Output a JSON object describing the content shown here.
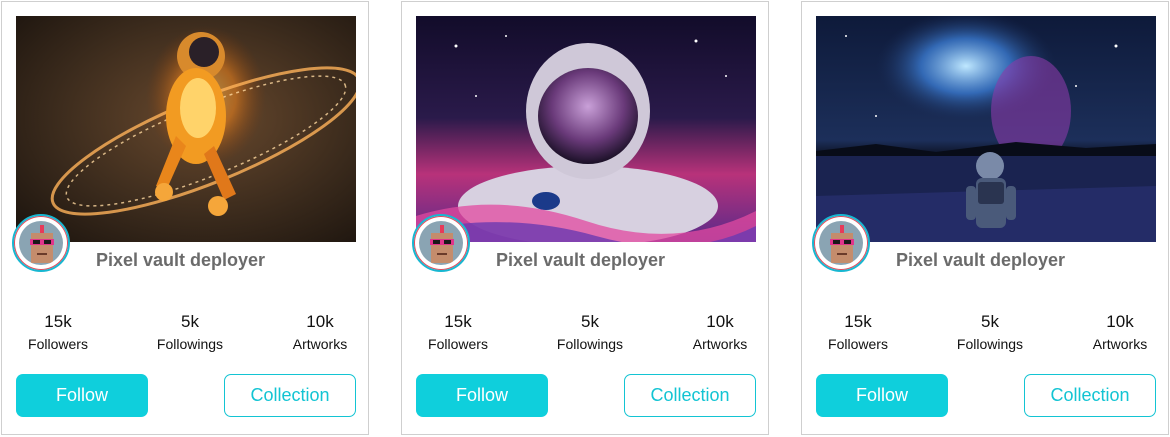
{
  "cards": [
    {
      "artwork": "glowing-astronaut-ring-artwork",
      "name": "Pixel vault deployer",
      "stats": [
        {
          "value": "15k",
          "label": "Followers"
        },
        {
          "value": "5k",
          "label": "Followings"
        },
        {
          "value": "10k",
          "label": "Artworks"
        }
      ],
      "follow_label": "Follow",
      "collection_label": "Collection"
    },
    {
      "artwork": "astronaut-in-cosmic-water-artwork",
      "name": "Pixel vault deployer",
      "stats": [
        {
          "value": "15k",
          "label": "Followers"
        },
        {
          "value": "5k",
          "label": "Followings"
        },
        {
          "value": "10k",
          "label": "Artworks"
        }
      ],
      "follow_label": "Follow",
      "collection_label": "Collection"
    },
    {
      "artwork": "astronaut-in-field-galaxy-artwork",
      "name": "Pixel vault deployer",
      "stats": [
        {
          "value": "15k",
          "label": "Followers"
        },
        {
          "value": "5k",
          "label": "Followings"
        },
        {
          "value": "10k",
          "label": "Artworks"
        }
      ],
      "follow_label": "Follow",
      "collection_label": "Collection"
    }
  ],
  "colors": {
    "accent": "#0fcfdc",
    "border": "#cfcfcf",
    "name_text": "#6b6b6b",
    "avatar_ring": "#18b7d1"
  }
}
